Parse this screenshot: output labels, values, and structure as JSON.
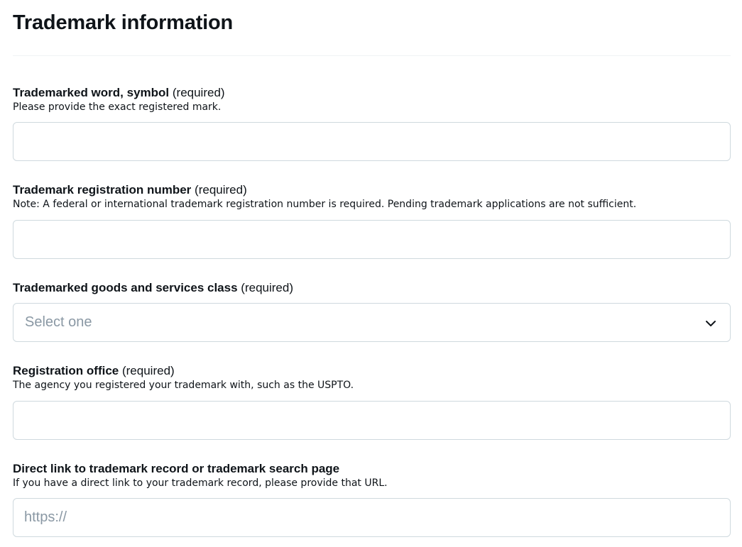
{
  "page": {
    "title": "Trademark information"
  },
  "fields": {
    "trademarked_word": {
      "label": "Trademarked word, symbol",
      "required": "(required)",
      "help": "Please provide the exact registered mark.",
      "value": ""
    },
    "registration_number": {
      "label": "Trademark registration number",
      "required": "(required)",
      "help": "Note: A federal or international trademark registration number is required. Pending trademark applications are not sufficient.",
      "value": ""
    },
    "goods_services_class": {
      "label": "Trademarked goods and services class",
      "required": "(required)",
      "selected": "Select one",
      "icon": "chevron-down-icon"
    },
    "registration_office": {
      "label": "Registration office",
      "required": "(required)",
      "help": "The agency you registered your trademark with, such as the USPTO.",
      "value": ""
    },
    "direct_link": {
      "label": "Direct link to trademark record or trademark search page",
      "help": "If you have a direct link to your trademark record, please provide that URL.",
      "placeholder": "https://",
      "value": ""
    }
  },
  "colors": {
    "text": "#0f1419",
    "border": "#cfd9de",
    "divider": "#eff3f4",
    "placeholder": "#8a98a4"
  }
}
